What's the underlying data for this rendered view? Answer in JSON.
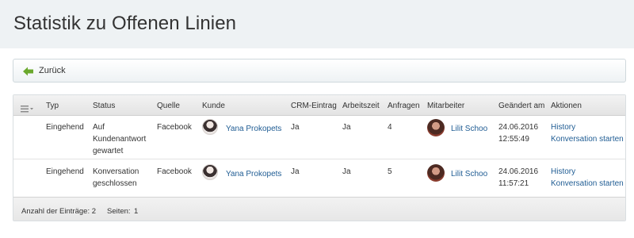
{
  "page": {
    "title": "Statistik zu Offenen Linien"
  },
  "toolbar": {
    "back_label": "Zurück"
  },
  "table": {
    "headers": {
      "typ": "Typ",
      "status": "Status",
      "quelle": "Quelle",
      "kunde": "Kunde",
      "crm": "CRM-Eintrag",
      "arbeitszeit": "Arbeitszeit",
      "anfragen": "Anfragen",
      "mitarbeiter": "Mitarbeiter",
      "geaendert": "Geändert am",
      "aktionen": "Aktionen"
    },
    "rows": [
      {
        "typ": "Eingehend",
        "status_lines": [
          "Auf",
          "Kundenantwort",
          "gewartet"
        ],
        "quelle": "Facebook",
        "kunde": "Yana Prokopets",
        "crm": "Ja",
        "arbeitszeit": "Ja",
        "anfragen": "4",
        "mitarbeiter": "Lilit Schoo",
        "date": "24.06.2016",
        "time": "12:55:49",
        "action_history": "History",
        "action_start": "Konversation starten"
      },
      {
        "typ": "Eingehend",
        "status_lines": [
          "Konversation",
          "geschlossen"
        ],
        "quelle": "Facebook",
        "kunde": "Yana Prokopets",
        "crm": "Ja",
        "arbeitszeit": "Ja",
        "anfragen": "5",
        "mitarbeiter": "Lilit Schoo",
        "date": "24.06.2016",
        "time": "11:57:21",
        "action_history": "History",
        "action_start": "Konversation starten"
      }
    ],
    "footer": {
      "count_label": "Anzahl der Einträge: 2",
      "pages_label": "Seiten:",
      "page_number": "1"
    }
  },
  "colors": {
    "link": "#1f5c93",
    "back_arrow": "#6aa82c"
  },
  "icons": {
    "back": "back-arrow-icon",
    "menu": "column-menu-icon",
    "avatar_customer": "customer-avatar",
    "avatar_agent": "agent-avatar"
  }
}
